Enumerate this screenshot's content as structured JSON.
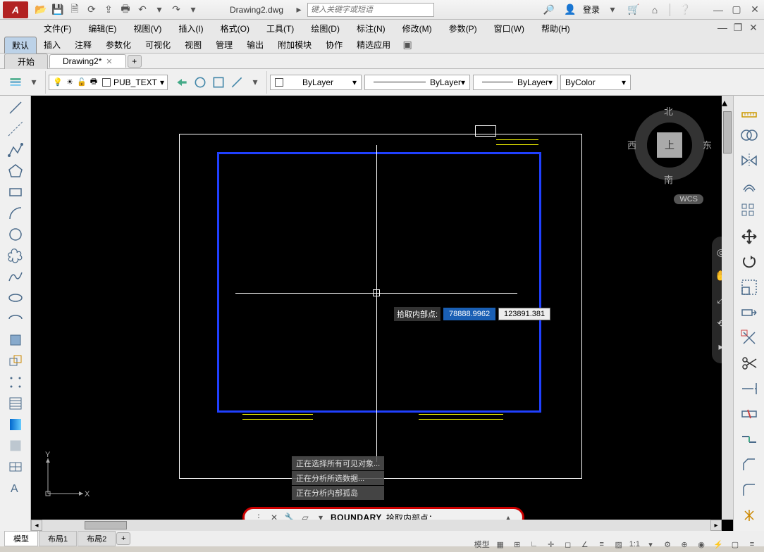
{
  "app": {
    "logo": "A",
    "title": "Drawing2.dwg",
    "search_placeholder": "键入关键字或短语",
    "login": "登录"
  },
  "menu": [
    "文件(F)",
    "编辑(E)",
    "视图(V)",
    "插入(I)",
    "格式(O)",
    "工具(T)",
    "绘图(D)",
    "标注(N)",
    "修改(M)",
    "参数(P)",
    "窗口(W)",
    "帮助(H)"
  ],
  "ribbon_tabs": [
    "默认",
    "插入",
    "注释",
    "参数化",
    "可视化",
    "视图",
    "管理",
    "输出",
    "附加模块",
    "协作",
    "精选应用"
  ],
  "file_tabs": {
    "start": "开始",
    "active": "Drawing2*"
  },
  "layer": {
    "name": "PUB_TEXT"
  },
  "props": {
    "bylayer1": "ByLayer",
    "bylayer2": "ByLayer",
    "bylayer3": "ByLayer",
    "bycolor": "ByColor"
  },
  "viewcube": {
    "n": "北",
    "s": "南",
    "e": "东",
    "w": "西",
    "top": "上",
    "wcs": "WCS"
  },
  "coord": {
    "label": "拾取内部点:",
    "x": "78888.9962",
    "y": "123891.381"
  },
  "history": [
    "正在选择所有可见对象...",
    "正在分析所选数据...",
    "正在分析内部孤岛"
  ],
  "command": {
    "name": "BOUNDARY",
    "prompt": "拾取内部点："
  },
  "ucs": {
    "x": "X",
    "y": "Y"
  },
  "bottom_tabs": {
    "model": "模型",
    "layout1": "布局1",
    "layout2": "布局2"
  },
  "status": {
    "model": "模型",
    "ratio": "1:1"
  }
}
